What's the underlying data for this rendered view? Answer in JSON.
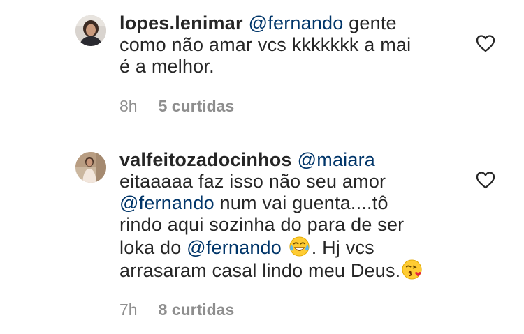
{
  "comments": [
    {
      "username": "lopes.lenimar",
      "lines": [
        {
          "mention": "@fernando",
          "text": " gente"
        },
        {
          "text": "como  não amar vcs kkkkkkk a mai"
        },
        {
          "text": "é a melhor."
        }
      ],
      "time": "8h",
      "likes": "5 curtidas",
      "avatar_icon": "profile-photo",
      "like_icon": "heart-outline-icon"
    },
    {
      "username": "valfeitozadocinhos",
      "mention": "@maiara",
      "lines": [
        {
          "text": "eitaaaaa faz isso não seu amor"
        },
        {
          "mention": "@fernando",
          "text": " num vai guenta....tô"
        },
        {
          "text": "rindo aqui sozinha do para de ser"
        },
        {
          "pre": "loka do ",
          "mention": "@fernando",
          "emoji": "face-with-tears-of-joy",
          "text": ". Hj vcs"
        },
        {
          "text": "arrasaram casal lindo meu Deus.",
          "emoji": "face-blowing-a-kiss"
        }
      ],
      "time": "7h",
      "likes": "8 curtidas",
      "avatar_icon": "profile-photo",
      "like_icon": "heart-outline-icon"
    }
  ],
  "colors": {
    "text": "#262626",
    "mention": "#003569",
    "meta": "#8e8e8e",
    "background": "#ffffff"
  }
}
